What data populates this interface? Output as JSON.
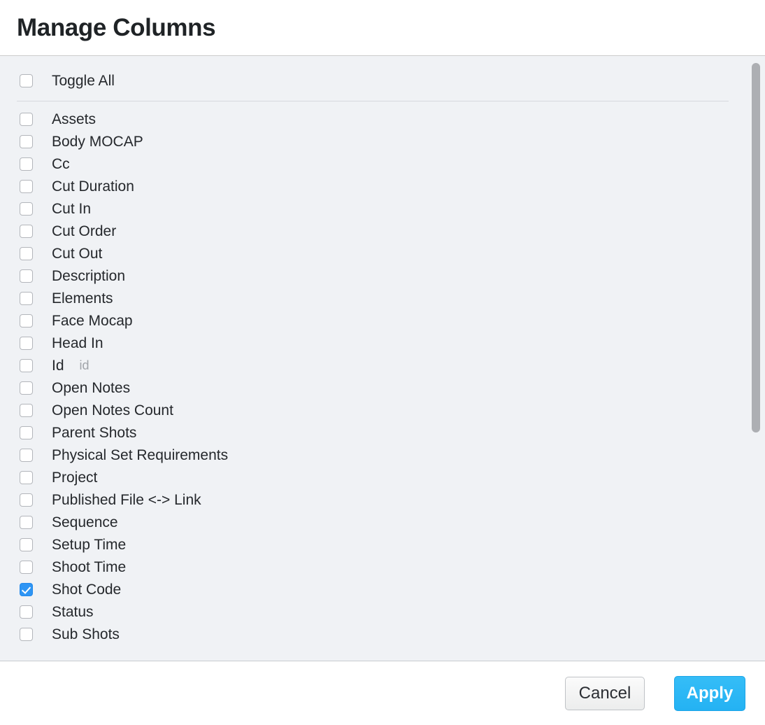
{
  "header": {
    "title": "Manage Columns"
  },
  "list": {
    "toggle_all": {
      "label": "Toggle All",
      "checked": false
    },
    "items": [
      {
        "label": "Assets",
        "checked": false
      },
      {
        "label": "Body MOCAP",
        "checked": false
      },
      {
        "label": "Cc",
        "checked": false
      },
      {
        "label": "Cut Duration",
        "checked": false
      },
      {
        "label": "Cut In",
        "checked": false
      },
      {
        "label": "Cut Order",
        "checked": false
      },
      {
        "label": "Cut Out",
        "checked": false
      },
      {
        "label": "Description",
        "checked": false
      },
      {
        "label": "Elements",
        "checked": false
      },
      {
        "label": "Face Mocap",
        "checked": false
      },
      {
        "label": "Head In",
        "checked": false
      },
      {
        "label": "Id",
        "sub": "id",
        "checked": false
      },
      {
        "label": "Open Notes",
        "checked": false
      },
      {
        "label": "Open Notes Count",
        "checked": false
      },
      {
        "label": "Parent Shots",
        "checked": false
      },
      {
        "label": "Physical Set Requirements",
        "checked": false
      },
      {
        "label": "Project",
        "checked": false
      },
      {
        "label": "Published File <-> Link",
        "checked": false
      },
      {
        "label": "Sequence",
        "checked": false
      },
      {
        "label": "Setup Time",
        "checked": false
      },
      {
        "label": "Shoot Time",
        "checked": false
      },
      {
        "label": "Shot Code",
        "checked": true
      },
      {
        "label": "Status",
        "checked": false
      },
      {
        "label": "Sub Shots",
        "checked": false
      }
    ]
  },
  "footer": {
    "cancel_label": "Cancel",
    "apply_label": "Apply"
  },
  "colors": {
    "accent_blue": "#2e95f4",
    "apply_blue": "#29b6f6",
    "body_background": "#f0f2f5",
    "text": "#25282c",
    "muted_text": "#a0a4aa",
    "scrollbar_thumb": "#adafb3"
  }
}
